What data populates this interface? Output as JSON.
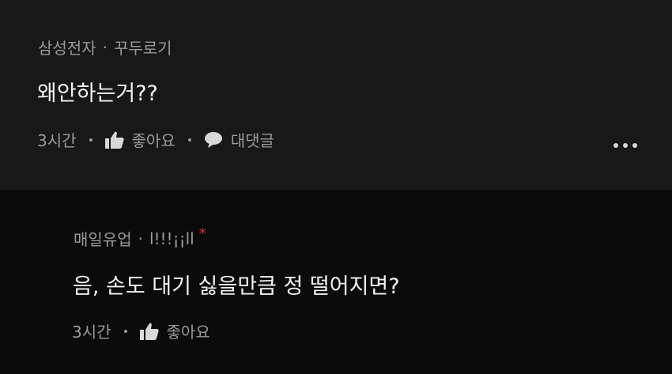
{
  "comments": [
    {
      "company": "삼성전자",
      "nickname": "꾸두로기",
      "text": "왜안하는거??",
      "time": "3시간",
      "like_label": "좋아요",
      "reply_label": "대댓글",
      "icons": {
        "like": "thumbs-up-icon",
        "reply": "speech-bubble-icon",
        "more": "more-dots-icon"
      }
    },
    {
      "company": "매일유업",
      "nickname": "l!!!¡¡ll",
      "badge": "*",
      "text": "음,  손도 대기 싫을만큼 정 떨어지면?",
      "time": "3시간",
      "like_label": "좋아요",
      "icons": {
        "like": "thumbs-up-icon"
      }
    }
  ],
  "colors": {
    "top_background": "#181818",
    "reply_background": "#0b0b0b",
    "primary_text": "#f2f2f2",
    "secondary_text": "#9a9a9a",
    "badge": "#e0302e"
  }
}
